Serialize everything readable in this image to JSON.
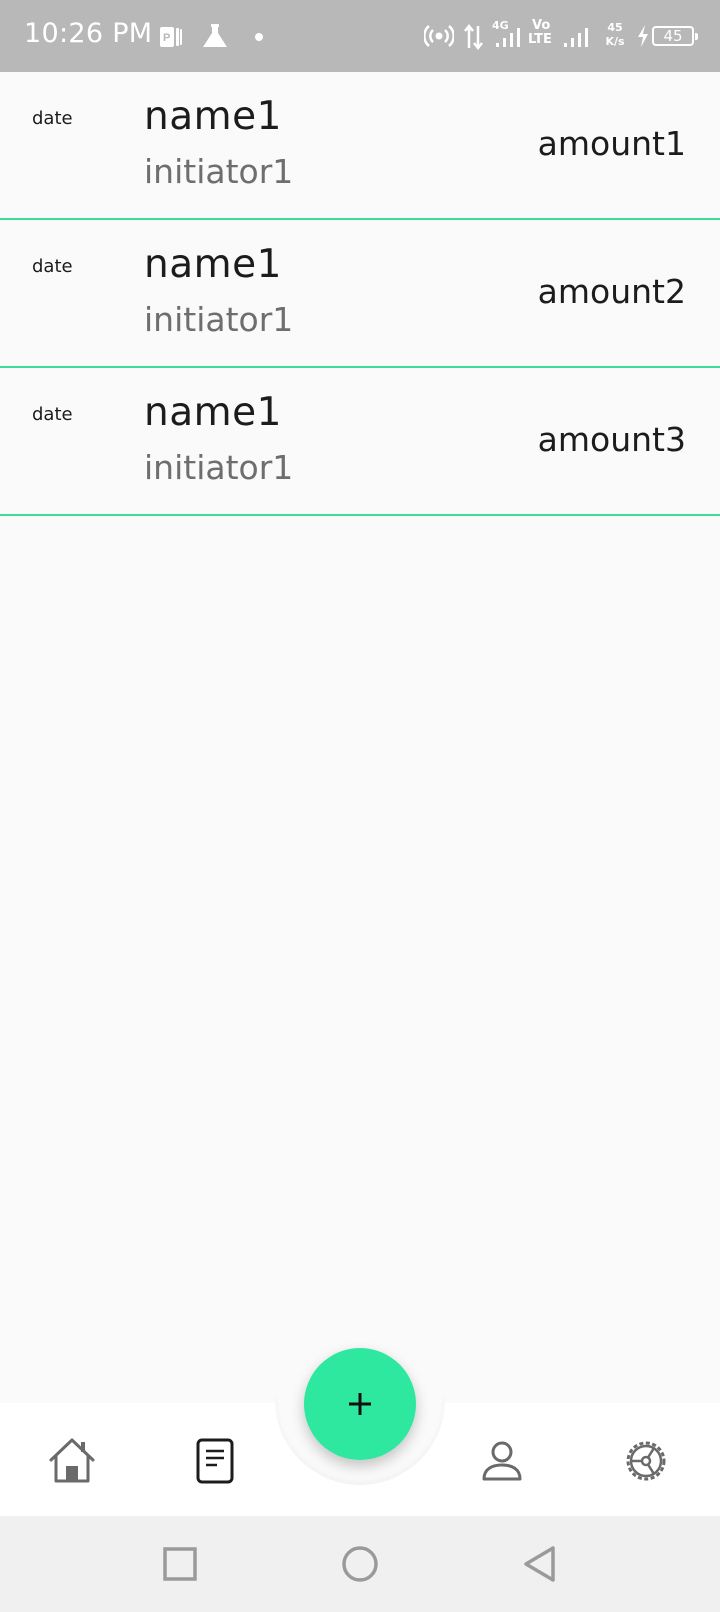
{
  "status_bar": {
    "time": "10:26 PM",
    "network_4g": "4G",
    "volte_top": "Vo",
    "volte_bottom": "LTE",
    "speed_value": "45",
    "speed_unit": "K/s",
    "battery": "45"
  },
  "transactions": [
    {
      "date": "date",
      "name": "name1",
      "initiator": "initiator1",
      "amount": "amount1"
    },
    {
      "date": "date",
      "name": "name1",
      "initiator": "initiator1",
      "amount": "amount2"
    },
    {
      "date": "date",
      "name": "name1",
      "initiator": "initiator1",
      "amount": "amount3"
    }
  ],
  "bottom_nav": {
    "items": [
      {
        "icon": "home-icon"
      },
      {
        "icon": "document-icon"
      },
      {
        "icon": "person-icon"
      },
      {
        "icon": "settings-icon"
      }
    ],
    "fab_icon": "plus-icon"
  },
  "colors": {
    "accent": "#3ddc97",
    "fab": "#2ee8a0",
    "status_bar": "#b8b8b8",
    "secondary_text": "#6e6e6e"
  }
}
